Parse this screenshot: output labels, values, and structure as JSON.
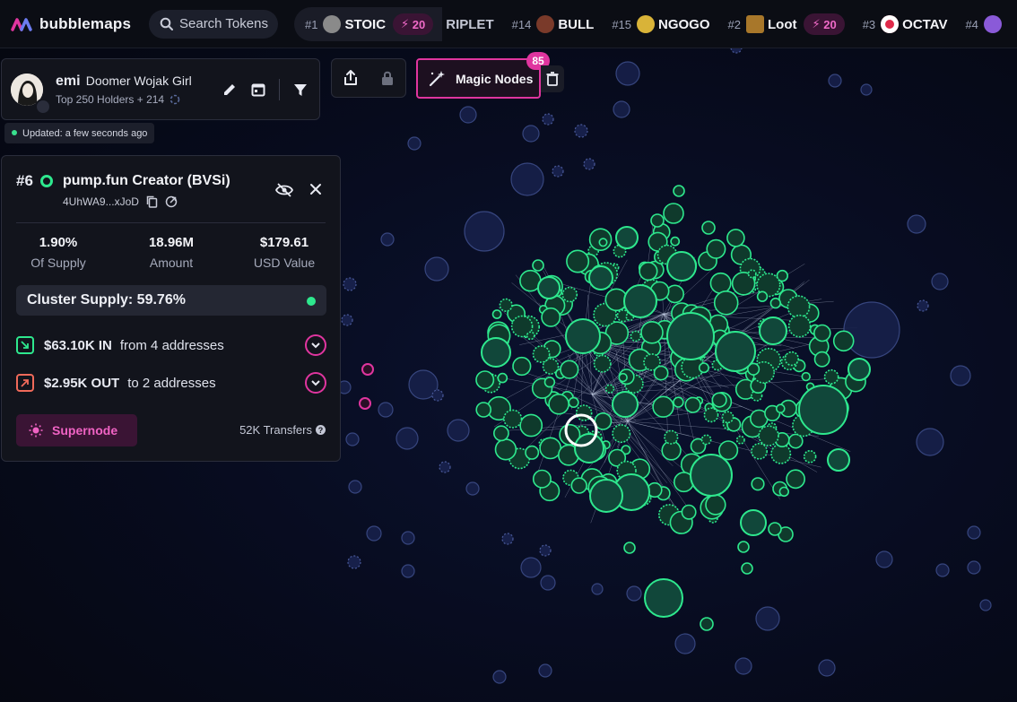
{
  "app": {
    "name": "bubblemaps"
  },
  "search": {
    "placeholder": "Search Tokens"
  },
  "ticker": [
    {
      "rank": "#1",
      "name": "STOIC",
      "boost": "20",
      "icon_color": "#8a8a8a"
    },
    {
      "rank": "",
      "name": "RIPLET",
      "boost": "",
      "icon_color": ""
    },
    {
      "rank": "#14",
      "name": "BULL",
      "boost": "",
      "icon_color": "#7a3a2a"
    },
    {
      "rank": "#15",
      "name": "NGOGO",
      "boost": "",
      "icon_color": "#d9b338"
    },
    {
      "rank": "#2",
      "name": "Loot",
      "boost": "20",
      "icon_color": "#a8772a"
    },
    {
      "rank": "#3",
      "name": "OCTAV",
      "boost": "",
      "icon_color": "#e02a4a"
    },
    {
      "rank": "#4",
      "name": "",
      "boost": "",
      "icon_color": "#8a5ad8"
    }
  ],
  "token": {
    "symbol": "emi",
    "name": "Doomer Wojak Girl",
    "holders_label": "Top 250 Holders + 214",
    "updated": "Updated: a few seconds ago"
  },
  "magic_nodes": {
    "label": "Magic Nodes",
    "count": "85"
  },
  "wallet": {
    "rank": "#6",
    "name": "pump.fun Creator (BVSi)",
    "address": "4UhWA9...xJoD",
    "stats": [
      {
        "value": "1.90%",
        "label": "Of Supply"
      },
      {
        "value": "18.96M",
        "label": "Amount"
      },
      {
        "value": "$179.61",
        "label": "USD Value"
      }
    ],
    "cluster_supply": "Cluster Supply: 59.76%",
    "in_amount": "$63.10K IN",
    "in_desc": "from 4 addresses",
    "out_amount": "$2.95K OUT",
    "out_desc": "to 2 addresses",
    "supernode_label": "Supernode",
    "transfers": "52K Transfers"
  },
  "colors": {
    "accent_pink": "#e0359f",
    "node_green": "#2ee88e",
    "node_blue": "#1e2a50",
    "in_green": "#2ee88e",
    "out_red": "#f06a5a"
  },
  "icons": [
    "search-icon",
    "edit-icon",
    "calendar-icon",
    "filter-icon",
    "share-icon",
    "lock-icon",
    "magic-wand-icon",
    "trash-icon",
    "copy-icon",
    "external-link-icon",
    "eye-off-icon",
    "close-icon",
    "arrow-in-icon",
    "arrow-out-icon",
    "chevron-down-icon",
    "sun-icon",
    "help-icon"
  ]
}
